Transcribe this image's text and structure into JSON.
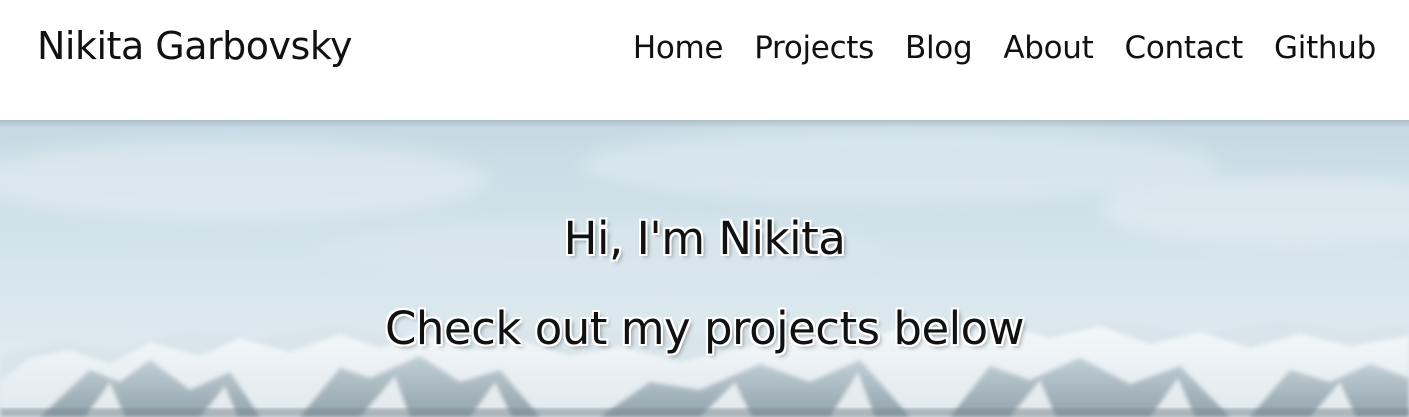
{
  "header": {
    "brand": "Nikita Garbovsky",
    "nav": [
      {
        "label": "Home"
      },
      {
        "label": "Projects"
      },
      {
        "label": "Blog"
      },
      {
        "label": "About"
      },
      {
        "label": "Contact"
      },
      {
        "label": "Github"
      }
    ]
  },
  "hero": {
    "greeting": "Hi, I'm Nikita",
    "tagline": "Check out my projects below"
  },
  "colors": {
    "text": "#111111",
    "header_bg": "#ffffff",
    "sky": "#c9dde6",
    "snow": "#eef4f7",
    "rock": "#7d8e98"
  }
}
